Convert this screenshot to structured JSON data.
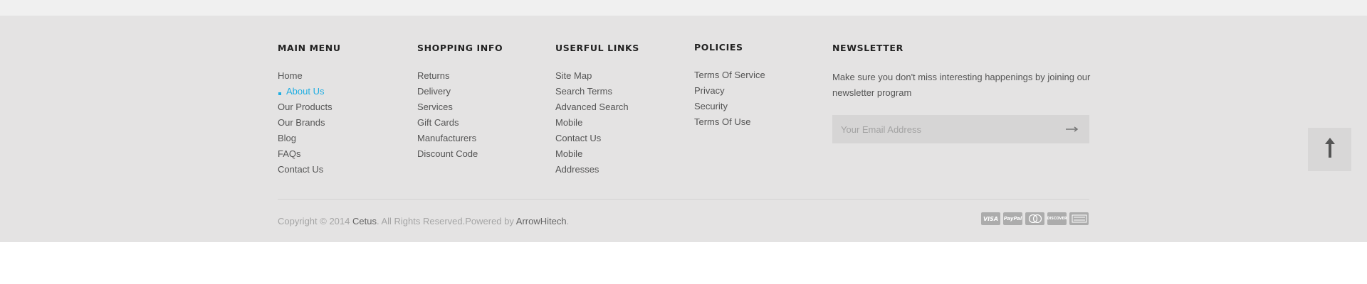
{
  "footer": {
    "columns": [
      {
        "title": "MAIN MENU",
        "items": [
          "Home",
          "About Us",
          "Our Products",
          "Our Brands",
          "Blog",
          "FAQs",
          "Contact Us"
        ],
        "active_item": "About Us"
      },
      {
        "title": "SHOPPING INFO",
        "items": [
          "Returns",
          "Delivery",
          "Services",
          "Gift Cards",
          "Manufacturers",
          "Discount Code"
        ]
      },
      {
        "title": "USERFUL LINKS",
        "items": [
          "Site Map",
          "Search Terms",
          "Advanced Search",
          "Mobile",
          "Contact Us",
          "Mobile",
          "Addresses"
        ]
      },
      {
        "title": "POLICIES",
        "items": [
          "Terms Of Service",
          "Privacy",
          "Security",
          "Terms Of Use"
        ]
      }
    ],
    "newsletter": {
      "title": "NEWSLETTER",
      "text": "Make sure you don't miss interesting happenings by joining our newsletter program",
      "email_placeholder": "Your Email Address",
      "submit_icon": "arrow-right-icon"
    },
    "copyright": {
      "prefix": "Copyright © 2014",
      "brand": "Cetus",
      "middle": ". All Rights Reserved.Powered by",
      "powered_by": "ArrowHitech",
      "suffix": "."
    },
    "payment_methods": [
      "VISA",
      "PayPal",
      "MasterCard",
      "Discover",
      "American Express"
    ],
    "scroll_top_icon": "arrow-up-icon"
  },
  "colors": {
    "footer_bg": "#e4e3e3",
    "accent": "#21aee2",
    "text": "#555555",
    "heading": "#222222"
  }
}
